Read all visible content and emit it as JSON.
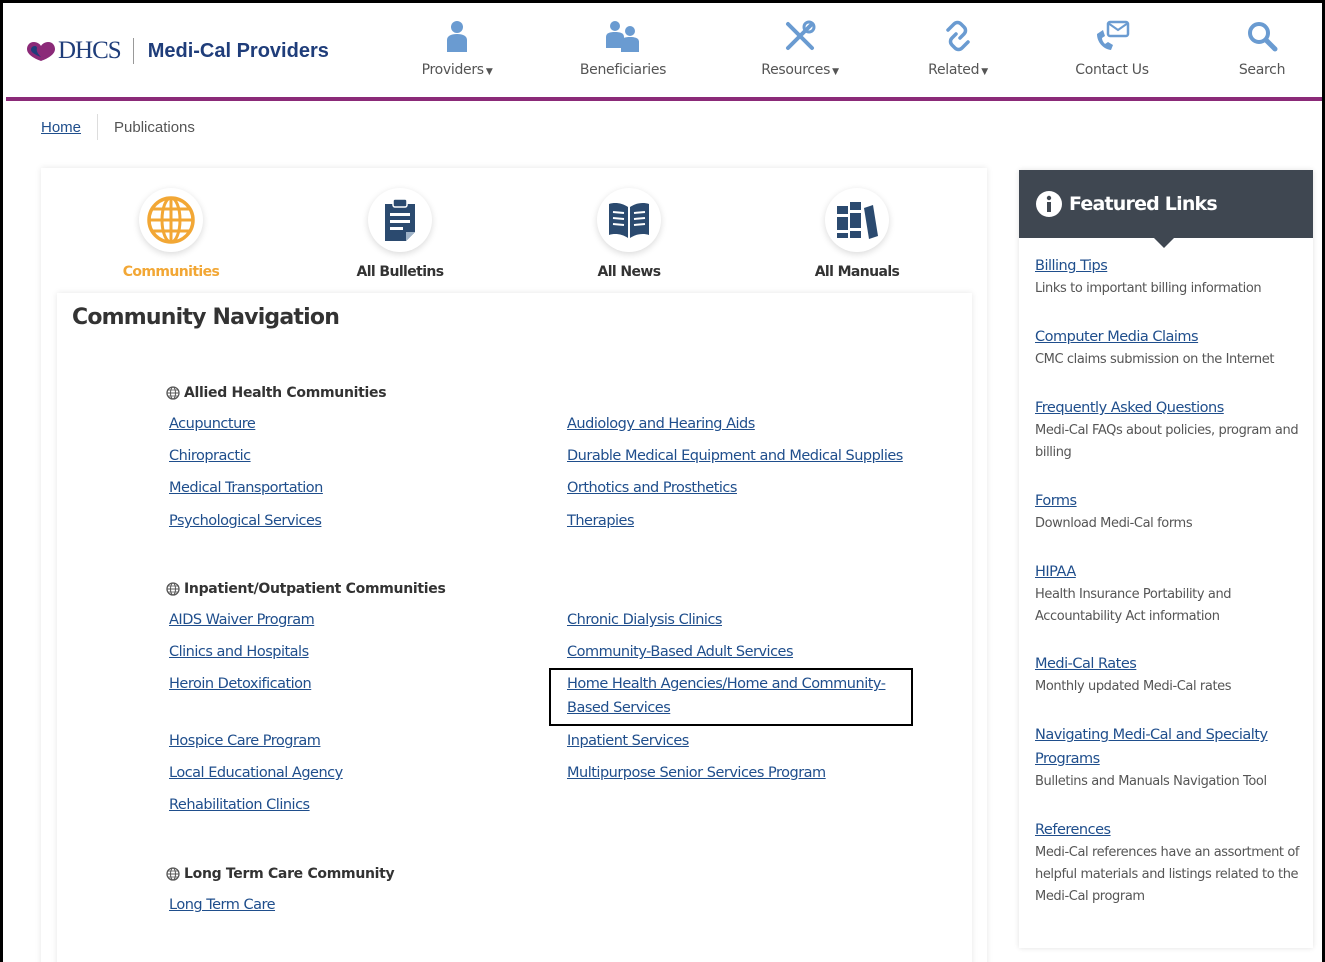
{
  "header": {
    "logo_text": "DHCS",
    "site_title": "Medi-Cal Providers",
    "nav": [
      {
        "label": "Providers",
        "icon": "person-icon",
        "dropdown": true
      },
      {
        "label": "Beneficiaries",
        "icon": "people-icon",
        "dropdown": false
      },
      {
        "label": "Resources",
        "icon": "tools-icon",
        "dropdown": true
      },
      {
        "label": "Related",
        "icon": "link-icon",
        "dropdown": true
      },
      {
        "label": "Contact Us",
        "icon": "contact-icon",
        "dropdown": false
      },
      {
        "label": "Search",
        "icon": "search-icon",
        "dropdown": false
      }
    ],
    "accent_color": "#8b2a78",
    "brand_color": "#1f3d7a"
  },
  "breadcrumb": {
    "home": "Home",
    "current": "Publications"
  },
  "tiles": [
    {
      "label": "Communities",
      "icon": "globe-icon",
      "active": true
    },
    {
      "label": "All Bulletins",
      "icon": "bulletin-icon",
      "active": false
    },
    {
      "label": "All News",
      "icon": "news-icon",
      "active": false
    },
    {
      "label": "All Manuals",
      "icon": "manuals-icon",
      "active": false
    }
  ],
  "community_nav": {
    "title": "Community Navigation",
    "sections": [
      {
        "heading": "Allied Health Communities",
        "left": [
          "Acupuncture",
          "Chiropractic",
          "Medical Transportation",
          "Psychological Services"
        ],
        "right": [
          "Audiology and Hearing Aids",
          "Durable Medical Equipment and Medical Supplies",
          "Orthotics and Prosthetics",
          "Therapies"
        ]
      },
      {
        "heading": "Inpatient/Outpatient Communities",
        "left": [
          "AIDS Waiver Program",
          "Clinics and Hospitals",
          "Heroin Detoxification",
          "Hospice Care Program",
          "Local Educational Agency",
          "Rehabilitation Clinics"
        ],
        "right": [
          "Chronic Dialysis Clinics",
          "Community-Based Adult Services",
          "Home Health Agencies/Home and Community-Based Services",
          "Inpatient Services",
          "Multipurpose Senior Services Program"
        ]
      },
      {
        "heading": "Long Term Care Community",
        "left": [
          "Long Term Care"
        ],
        "right": []
      }
    ]
  },
  "featured": {
    "title": "Featured Links",
    "items": [
      {
        "link": "Billing Tips",
        "desc": "Links to important billing information"
      },
      {
        "link": "Computer Media Claims",
        "desc": "CMC claims submission on the Internet"
      },
      {
        "link": "Frequently Asked Questions",
        "desc": "Medi-Cal FAQs about policies, program and billing"
      },
      {
        "link": "Forms",
        "desc": "Download Medi-Cal forms"
      },
      {
        "link": "HIPAA",
        "desc": "Health Insurance Portability and Accountability Act information"
      },
      {
        "link": "Medi-Cal Rates",
        "desc": "Monthly updated Medi-Cal rates"
      },
      {
        "link": "Navigating Medi-Cal and Specialty Programs",
        "desc": "Bulletins and Manuals Navigation Tool"
      },
      {
        "link": "References",
        "desc": "Medi-Cal references have an assortment of helpful materials and listings related to the Medi-Cal program"
      }
    ]
  }
}
